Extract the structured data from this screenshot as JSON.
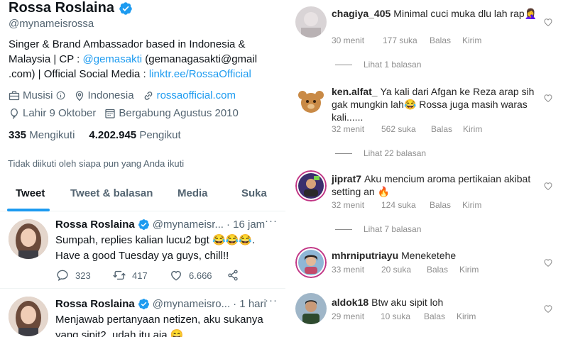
{
  "profile": {
    "name": "Rossa Roslaina",
    "handle": "@mynameisrossa",
    "bio_text_1": "Singer & Brand Ambassador based in Indonesia & Malaysia | CP : ",
    "bio_link_1": "@gemasakti",
    "bio_text_2": " (gemanagasakti@gmail .com) | Official Social Media : ",
    "bio_link_2": "linktr.ee/RossaOfficial",
    "category": "Musisi",
    "location": "Indonesia",
    "website": "rossaofficial.com",
    "birthday": "Lahir 9 Oktober",
    "joined": "Bergabung Agustus 2010",
    "following_count": "335",
    "following_label": "Mengikuti",
    "followers_count": "4.202.945",
    "followers_label": "Pengikut",
    "not_followed_text": "Tidak diikuti oleh siapa pun yang Anda ikuti"
  },
  "tabs": [
    {
      "label": "Tweet"
    },
    {
      "label": "Tweet & balasan"
    },
    {
      "label": "Media"
    },
    {
      "label": "Suka"
    }
  ],
  "tweets": [
    {
      "name": "Rossa Roslaina",
      "handle": "@mynameisr...",
      "time": "· 16 jam",
      "text": "Sumpah, replies kalian lucu2 bgt 😂😂😂. Have a good Tuesday ya guys, chill!!",
      "replies": "323",
      "retweets": "417",
      "likes": "6.666"
    },
    {
      "name": "Rossa Roslaina",
      "handle": "@mynameisro...",
      "time": "· 1 hari",
      "text": "Menjawab pertanyaan netizen, aku sukanya yang sipit2, udah itu aja 😄.",
      "replies": "",
      "retweets": "",
      "likes": ""
    }
  ],
  "comments": [
    {
      "user": "chagiya_405",
      "text": "Minimal cuci muka dlu lah rap🤦‍♀️",
      "time": "30 menit",
      "likes": "177 suka",
      "reply": "Balas",
      "send": "Kirim",
      "view_replies": "Lihat 1 balasan"
    },
    {
      "user": "ken.alfat_",
      "text": "Ya kali dari Afgan ke Reza arap sih gak mungkin lah😂 Rossa juga masih waras kali......",
      "time": "32 menit",
      "likes": "562 suka",
      "reply": "Balas",
      "send": "Kirim",
      "view_replies": "Lihat 22 balasan"
    },
    {
      "user": "jiprat7",
      "text": "Aku mencium aroma pertikaian akibat setting an 🔥",
      "time": "32 menit",
      "likes": "124 suka",
      "reply": "Balas",
      "send": "Kirim",
      "view_replies": "Lihat 7 balasan"
    },
    {
      "user": "mhrniputriayu",
      "text": "Meneketehe",
      "time": "33 menit",
      "likes": "20 suka",
      "reply": "Balas",
      "send": "Kirim",
      "view_replies": ""
    },
    {
      "user": "aldok18",
      "text": "Btw aku sipit loh",
      "time": "29 menit",
      "likes": "10 suka",
      "reply": "Balas",
      "send": "Kirim",
      "view_replies": ""
    }
  ],
  "colors": {
    "twitter_blue": "#1d9bf0",
    "text_primary": "#0f1419",
    "text_secondary": "#536471",
    "ig_secondary": "#8e8e8e"
  },
  "icons": [
    "verified-badge-icon",
    "briefcase-icon",
    "info-icon",
    "location-pin-icon",
    "link-icon",
    "balloon-icon",
    "calendar-icon",
    "reply-icon",
    "retweet-icon",
    "like-icon",
    "share-icon",
    "more-icon",
    "heart-outline-icon"
  ]
}
